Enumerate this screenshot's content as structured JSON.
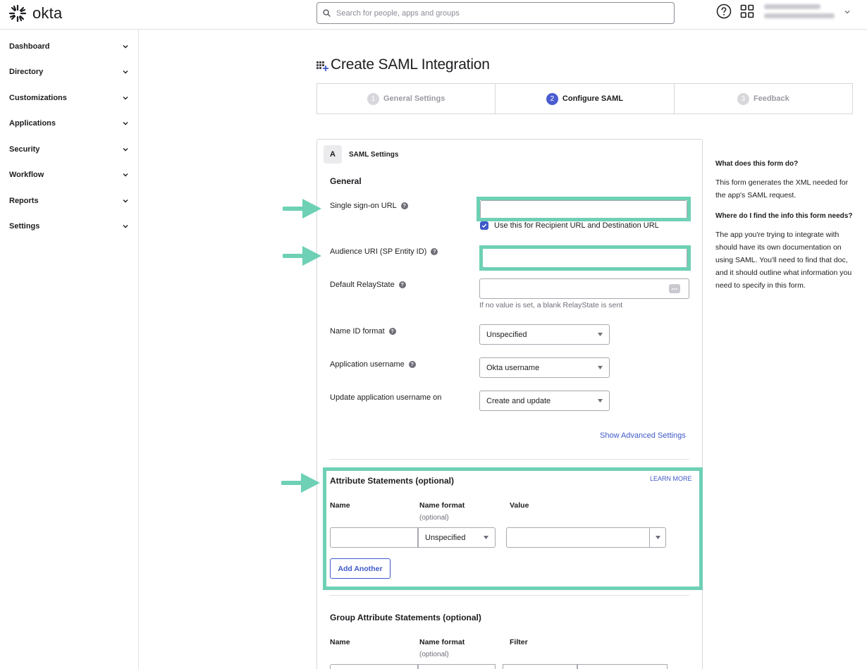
{
  "header": {
    "logo_text": "okta",
    "search_placeholder": "Search for people, apps and groups"
  },
  "sidebar": {
    "items": [
      {
        "label": "Dashboard"
      },
      {
        "label": "Directory"
      },
      {
        "label": "Customizations"
      },
      {
        "label": "Applications"
      },
      {
        "label": "Security"
      },
      {
        "label": "Workflow"
      },
      {
        "label": "Reports"
      },
      {
        "label": "Settings"
      }
    ]
  },
  "page": {
    "title": "Create SAML Integration",
    "steps": [
      {
        "num": "1",
        "label": "General Settings"
      },
      {
        "num": "2",
        "label": "Configure SAML"
      },
      {
        "num": "3",
        "label": "Feedback"
      }
    ]
  },
  "form": {
    "badge": "A",
    "heading": "SAML Settings",
    "general_title": "General",
    "sso_url_label": "Single sign-on URL",
    "sso_url_value": "",
    "recipient_checkbox_label": "Use this for Recipient URL and Destination URL",
    "audience_label": "Audience URI (SP Entity ID)",
    "audience_value": "",
    "relay_label": "Default RelayState",
    "relay_value": "",
    "relay_hint": "If no value is set, a blank RelayState is sent",
    "nameid_label": "Name ID format",
    "nameid_value": "Unspecified",
    "appuser_label": "Application username",
    "appuser_value": "Okta username",
    "update_label": "Update application username on",
    "update_value": "Create and update",
    "advanced_link": "Show Advanced Settings"
  },
  "attributes": {
    "title": "Attribute Statements (optional)",
    "learn_more": "LEARN MORE",
    "col_name": "Name",
    "col_format": "Name format",
    "col_format_sub": "(optional)",
    "col_value": "Value",
    "format_value": "Unspecified",
    "add_button": "Add Another"
  },
  "group_attributes": {
    "title": "Group Attribute Statements (optional)",
    "col_name": "Name",
    "col_format": "Name format",
    "col_format_sub": "(optional)",
    "col_filter": "Filter"
  },
  "help": {
    "q1": "What does this form do?",
    "a1": "This form generates the XML needed for the app's SAML request.",
    "q2": "Where do I find the info this form needs?",
    "a2": "The app you're trying to integrate with should have its own documentation on using SAML. You'll need to find that doc, and it should outline what information you need to specify in this form."
  },
  "colors": {
    "accent": "#3f59c9",
    "highlight": "#6ed0b5"
  }
}
